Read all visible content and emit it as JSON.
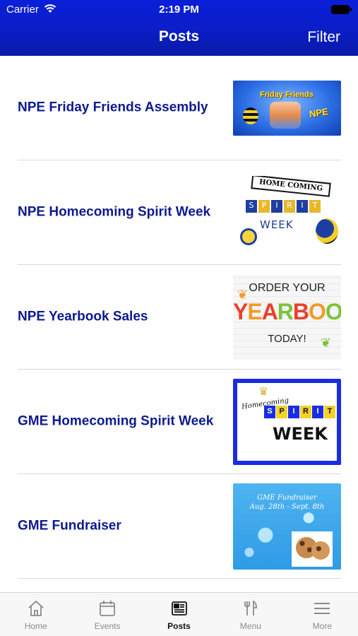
{
  "status_bar": {
    "carrier": "Carrier",
    "time": "2:19 PM"
  },
  "nav": {
    "title": "Posts",
    "filter_label": "Filter"
  },
  "posts": [
    {
      "title": "NPE Friday Friends Assembly",
      "thumb_text": [
        "Friday",
        "Friends",
        "NPE"
      ]
    },
    {
      "title": "NPE Homecoming Spirit Week",
      "thumb_text": [
        "HOME COMING",
        "S",
        "P",
        "I",
        "R",
        "I",
        "T",
        "WEEK"
      ]
    },
    {
      "title": "NPE Yearbook Sales",
      "thumb_text": [
        "ORDER YOUR",
        "YEARBOOK",
        "TODAY!"
      ]
    },
    {
      "title": "GME Homecoming Spirit Week",
      "thumb_text": [
        "Homecoming",
        "S",
        "P",
        "I",
        "R",
        "I",
        "T",
        "WEEK"
      ]
    },
    {
      "title": "GME Fundraiser",
      "thumb_text": [
        "GME Fundraiser",
        "Aug. 28th - Sept. 8th"
      ]
    }
  ],
  "tabs": [
    {
      "label": "Home",
      "icon": "home-icon",
      "active": false
    },
    {
      "label": "Events",
      "icon": "calendar-icon",
      "active": false
    },
    {
      "label": "Posts",
      "icon": "newspaper-icon",
      "active": true
    },
    {
      "label": "Menu",
      "icon": "fork-knife-icon",
      "active": false
    },
    {
      "label": "More",
      "icon": "hamburger-icon",
      "active": false
    }
  ],
  "colors": {
    "header": "#0b1ec9",
    "post_title": "#0d1a8f",
    "tab_active": "#111111",
    "tab_inactive": "#8a8a8a"
  }
}
